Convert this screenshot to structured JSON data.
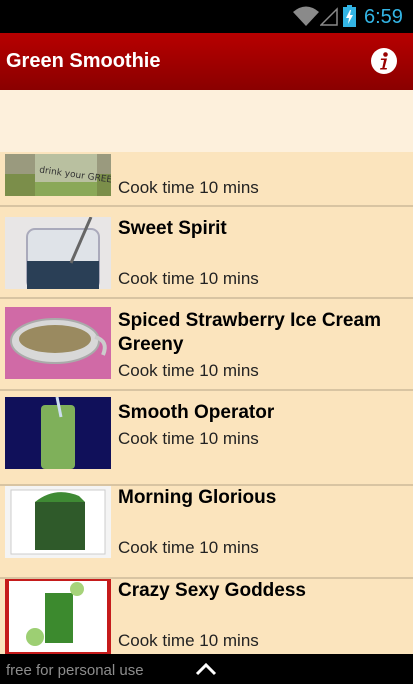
{
  "status_bar": {
    "time": "6:59",
    "accent": "#33b5e5"
  },
  "app_bar": {
    "title": "Green Smoothie",
    "info_icon": "info-icon",
    "color": "#a80000"
  },
  "items": [
    {
      "title": "",
      "subtitle": "Cook time 10 mins",
      "image_text": "drink your GREENS"
    },
    {
      "title": "Sweet Spirit",
      "subtitle": "Cook time 10 mins"
    },
    {
      "title": "Spiced Strawberry Ice Cream Greeny",
      "subtitle": "Cook time 10 mins"
    },
    {
      "title": "Smooth Operator",
      "subtitle": "Cook time 10 mins"
    },
    {
      "title": "Morning Glorious",
      "subtitle": "Cook time 10 mins"
    },
    {
      "title": "Crazy Sexy Goddess",
      "subtitle": "Cook time 10 mins"
    }
  ],
  "footer": {
    "text": "free for personal use",
    "icon": "chevron-up-icon"
  }
}
